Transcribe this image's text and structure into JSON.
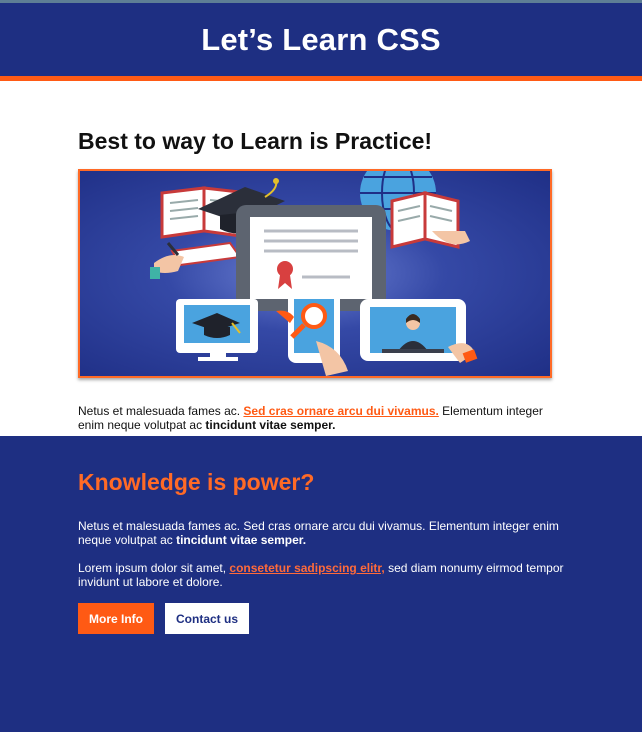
{
  "header": {
    "title": "Let’s Learn CSS"
  },
  "main": {
    "heading": "Best to way to Learn is Practice!",
    "paragraph": {
      "text_before": "Netus et malesuada fames ac. ",
      "link": "Sed cras ornare arcu dui vivamus.",
      "text_after": " Elementum integer enim neque volutpat ac ",
      "bold": "tincidunt vitae semper."
    }
  },
  "section": {
    "heading": "Knowledge is power?",
    "paragraph1": {
      "text": "Netus et malesuada fames ac. Sed cras ornare arcu dui vivamus. Elementum integer enim neque volutpat ac ",
      "bold": "tincidunt vitae semper."
    },
    "paragraph2": {
      "text_before": "Lorem ipsum dolor sit amet, ",
      "link": "consetetur sadipscing elitr,",
      "text_after": " sed diam nonumy eirmod tempor invidunt ut labore et dolore."
    },
    "buttons": {
      "more_info": "More Info",
      "contact": "Contact us"
    }
  },
  "colors": {
    "navy": "#1e2f82",
    "orange": "#ff5a14",
    "white": "#ffffff"
  }
}
